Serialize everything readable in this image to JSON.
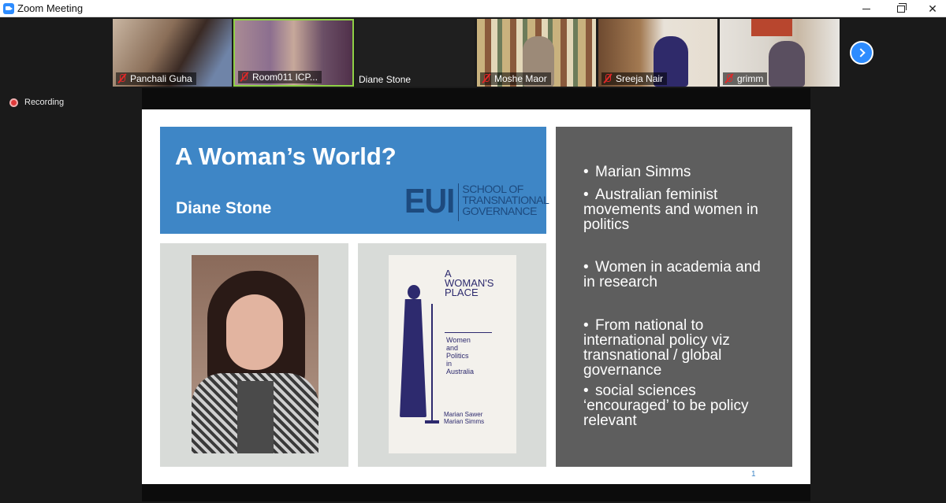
{
  "window": {
    "title": "Zoom Meeting"
  },
  "participants": [
    {
      "name": "Panchali Guha",
      "muted": true
    },
    {
      "name": "Room011 ICP...",
      "muted": true
    },
    {
      "name": "Diane Stone",
      "muted": false
    },
    {
      "name": "Moshe Maor",
      "muted": true
    },
    {
      "name": "Sreeja Nair",
      "muted": true
    },
    {
      "name": "grimm",
      "muted": true
    }
  ],
  "recording": {
    "label": "Recording"
  },
  "slide": {
    "title": "A Woman’s World?",
    "author": "Diane Stone",
    "logo": {
      "mark": "EUI",
      "line1": "SCHOOL OF",
      "line2": "TRANSNATIONAL",
      "line3": "GOVERNANCE"
    },
    "book": {
      "title_line1": "A",
      "title_line2": "WOMAN'S",
      "title_line3": "PLACE",
      "subtitle_line1": "Women",
      "subtitle_line2": "and",
      "subtitle_line3": "Politics",
      "subtitle_line4": "in",
      "subtitle_line5": "Australia",
      "author1": "Marian Sawer",
      "author2": "Marian Simms"
    },
    "bullets": [
      "Marian Simms",
      "Australian feminist movements and women in politics",
      "Women in academia and in research",
      "From national to international policy viz transnational / global governance",
      "social sciences ‘encouraged’ to be policy relevant"
    ],
    "page_number": "1"
  },
  "colors": {
    "accent": "#2d8cff",
    "title_box": "#3e86c6",
    "bullet_panel": "#5e5e5e",
    "muted_icon": "#e02828",
    "active_speaker_border": "#8ed046"
  }
}
